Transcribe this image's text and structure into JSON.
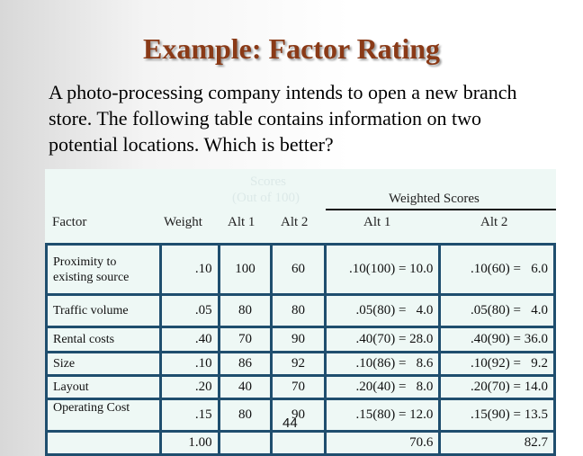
{
  "title": "Example: Factor Rating",
  "intro": "A photo-processing company intends to open a new branch store.  The following table contains information on two potential locations.  Which is better?",
  "table": {
    "header": {
      "scores": "Scores",
      "out_of": "(Out of 100)",
      "weighted": "Weighted Scores",
      "factor": "Factor",
      "weight": "Weight",
      "alt1": "Alt 1",
      "alt2": "Alt 2",
      "w_alt1": "Alt 1",
      "w_alt2": "Alt 2"
    },
    "rows": [
      {
        "factor": "Proximity to existing source",
        "weight": ".10",
        "alt1": "100",
        "alt2": "60",
        "w1": ".10(100) = 10.0",
        "w2": ".10(60) =   6.0"
      },
      {
        "factor": "Traffic volume",
        "weight": ".05",
        "alt1": "80",
        "alt2": "80",
        "w1": ".05(80) =   4.0",
        "w2": ".05(80) =   4.0"
      },
      {
        "factor": "Rental costs",
        "weight": ".40",
        "alt1": "70",
        "alt2": "90",
        "w1": ".40(70) = 28.0",
        "w2": ".40(90) = 36.0"
      },
      {
        "factor": "Size",
        "weight": ".10",
        "alt1": "86",
        "alt2": "92",
        "w1": ".10(86) =   8.6",
        "w2": ".10(92) =   9.2"
      },
      {
        "factor": "Layout",
        "weight": ".20",
        "alt1": "40",
        "alt2": "70",
        "w1": ".20(40) =   8.0",
        "w2": ".20(70) = 14.0"
      },
      {
        "factor": "Operating Cost",
        "weight": ".15",
        "alt1": "80",
        "alt2": "90",
        "w1": ".15(80) = 12.0",
        "w2": ".15(90) = 13.5"
      }
    ],
    "totals": {
      "weight": "1.00",
      "w1": "70.6",
      "w2": "82.7"
    }
  },
  "page_number": "44",
  "colors": {
    "title": "#8a3a17",
    "border": "#1f4e6e",
    "table_bg": "#eef8f5"
  }
}
